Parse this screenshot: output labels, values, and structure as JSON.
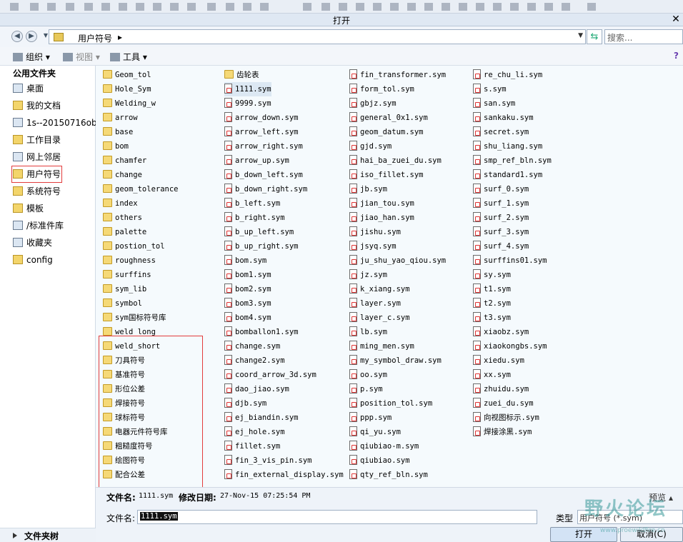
{
  "window": {
    "title": "打开",
    "close_glyph": "✕"
  },
  "address": {
    "path": "用户符号",
    "separator": "▸",
    "search_placeholder": "搜索..."
  },
  "toolbar": {
    "organize": "组织 ▾",
    "view": "视图 ▾",
    "tools": "工具 ▾",
    "help": "?"
  },
  "sidebar": {
    "header": "公用文件夹",
    "items": [
      "桌面",
      "我的文档",
      "1s--20150716obo",
      "工作目录",
      "网上邻居",
      "用户符号",
      "系统符号",
      "模板",
      "/标准件库",
      "收藏夹",
      "config"
    ],
    "footer": "文件夹树"
  },
  "files": {
    "col1": [
      "Geom_tol",
      "Hole_Sym",
      "Welding_w",
      "arrow",
      "base",
      "bom",
      "chamfer",
      "change",
      "geom_tolerance",
      "index",
      "others",
      "palette",
      "postion_tol",
      "roughness",
      "surffins",
      "sym_lib",
      "symbol",
      "sym国标符号库",
      "weld_long",
      "weld_short",
      "刀具符号",
      "基准符号",
      "形位公差",
      "焊接符号",
      "球标符号",
      "电器元件符号库",
      "粗糙度符号",
      "绘图符号",
      "配合公差"
    ],
    "col2": [
      "齿轮表",
      "1111.sym",
      "9999.sym",
      "arrow_down.sym",
      "arrow_left.sym",
      "arrow_right.sym",
      "arrow_up.sym",
      "b_down_left.sym",
      "b_down_right.sym",
      "b_left.sym",
      "b_right.sym",
      "b_up_left.sym",
      "b_up_right.sym",
      "bom.sym",
      "bom1.sym",
      "bom2.sym",
      "bom3.sym",
      "bom4.sym",
      "bomballon1.sym",
      "change.sym",
      "change2.sym",
      "coord_arrow_3d.sym",
      "dao_jiao.sym",
      "djb.sym",
      "ej_biandin.sym",
      "ej_hole.sym",
      "fillet.sym",
      "fin_3_vis_pin.sym",
      "fin_external_display.sym"
    ],
    "col3": [
      "fin_transformer.sym",
      "form_tol.sym",
      "gbjz.sym",
      "general_0x1.sym",
      "geom_datum.sym",
      "gjd.sym",
      "hai_ba_zuei_du.sym",
      "iso_fillet.sym",
      "jb.sym",
      "jian_tou.sym",
      "jiao_han.sym",
      "jishu.sym",
      "jsyq.sym",
      "ju_shu_yao_qiou.sym",
      "jz.sym",
      "k_xiang.sym",
      "layer.sym",
      "layer_c.sym",
      "lb.sym",
      "ming_men.sym",
      "my_symbol_draw.sym",
      "oo.sym",
      "p.sym",
      "position_tol.sym",
      "ppp.sym",
      "qi_yu.sym",
      "qiubiao-m.sym",
      "qiubiao.sym",
      "qty_ref_bln.sym"
    ],
    "col4": [
      "re_chu_li.sym",
      "s.sym",
      "san.sym",
      "sankaku.sym",
      "secret.sym",
      "shu_liang.sym",
      "smp_ref_bln.sym",
      "standard1.sym",
      "surf_0.sym",
      "surf_1.sym",
      "surf_2.sym",
      "surf_3.sym",
      "surf_4.sym",
      "surffins01.sym",
      "sy.sym",
      "t1.sym",
      "t2.sym",
      "t3.sym",
      "xiaobz.sym",
      "xiaokongbs.sym",
      "xiedu.sym",
      "xx.sym",
      "zhuidu.sym",
      "zuei_du.sym",
      "向视图标示.sym",
      "焊接涂黑.sym"
    ]
  },
  "status": {
    "filename_label": "文件名:",
    "filename_value": "1111.sym",
    "date_label": "修改日期:",
    "date_value": "27-Nov-15 07:25:54 PM",
    "preview": "预览 ▴"
  },
  "bottom": {
    "filename_label": "文件名:",
    "filename_value": "1111.sym",
    "type_label": "类型",
    "type_value": "用户符号 (*.sym)",
    "open": "打开",
    "cancel": "取消(C)"
  },
  "watermark": {
    "main": "野火论坛",
    "sub": "www.proewildfire.cn"
  }
}
